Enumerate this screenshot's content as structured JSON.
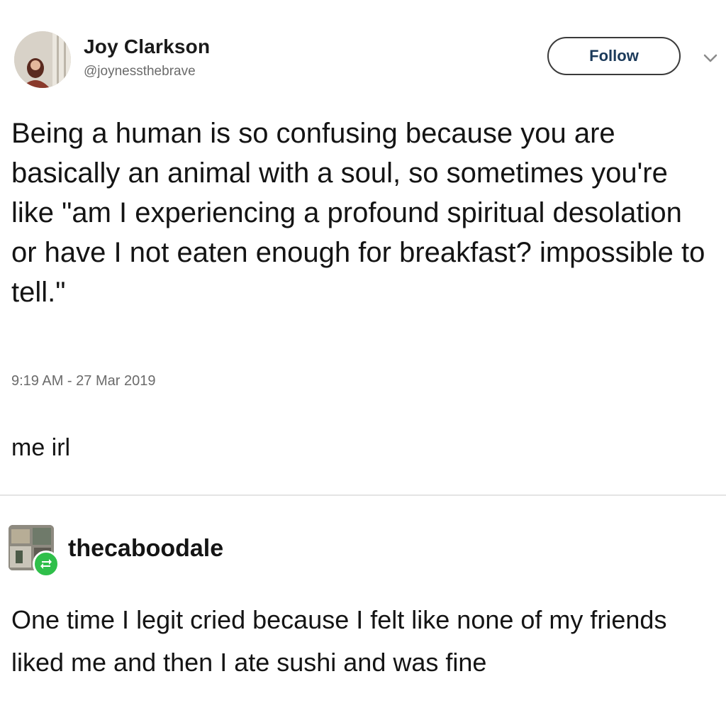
{
  "tweet": {
    "display_name": "Joy Clarkson",
    "handle": "@joynessthebrave",
    "follow_label": "Follow",
    "text": "Being a human is so confusing because you are basically an animal with a soul, so sometimes you're like \"am I experiencing a profound spiritual desolation or have I not eaten enough for breakfast? impossible to tell.\"",
    "timestamp": "9:19 AM - 27 Mar 2019",
    "icons": {
      "avatar": "user-avatar",
      "menu": "chevron-down-icon"
    },
    "colors": {
      "follow_text": "#1b3a5a"
    }
  },
  "caption": "me irl",
  "reblog": {
    "username": "thecaboodale",
    "text": "One time I legit cried because I felt like none of my friends liked me and then I ate sushi and was fine",
    "icons": {
      "avatar": "user-avatar",
      "badge": "reblog-icon"
    },
    "colors": {
      "badge": "#2fbf4a"
    }
  }
}
